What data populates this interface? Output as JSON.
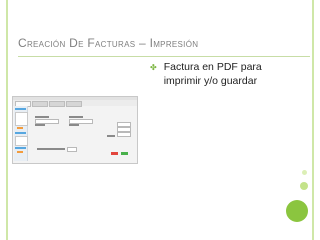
{
  "slide": {
    "title": "Creación de facturas – Impresión",
    "bullet": "Factura en PDF para imprimir y/o guardar",
    "bullet_icon": "curly-bullet-icon",
    "accent_color": "#7db643",
    "circle_color": "#8bc53f"
  }
}
